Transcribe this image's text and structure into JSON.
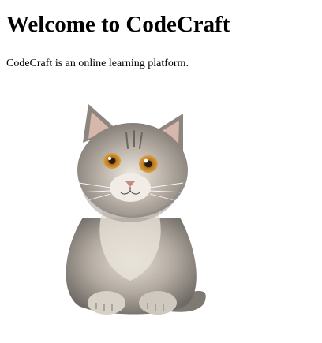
{
  "page": {
    "heading": "Welcome to CodeCraft",
    "description": "CodeCraft is an online learning platform."
  },
  "image": {
    "subject": "cat-photo",
    "colors": {
      "fur_light": "#d9d2c8",
      "fur_mid": "#a59d93",
      "fur_dark": "#6f6a66",
      "eye": "#c98a2a",
      "nose": "#c48a84"
    }
  }
}
